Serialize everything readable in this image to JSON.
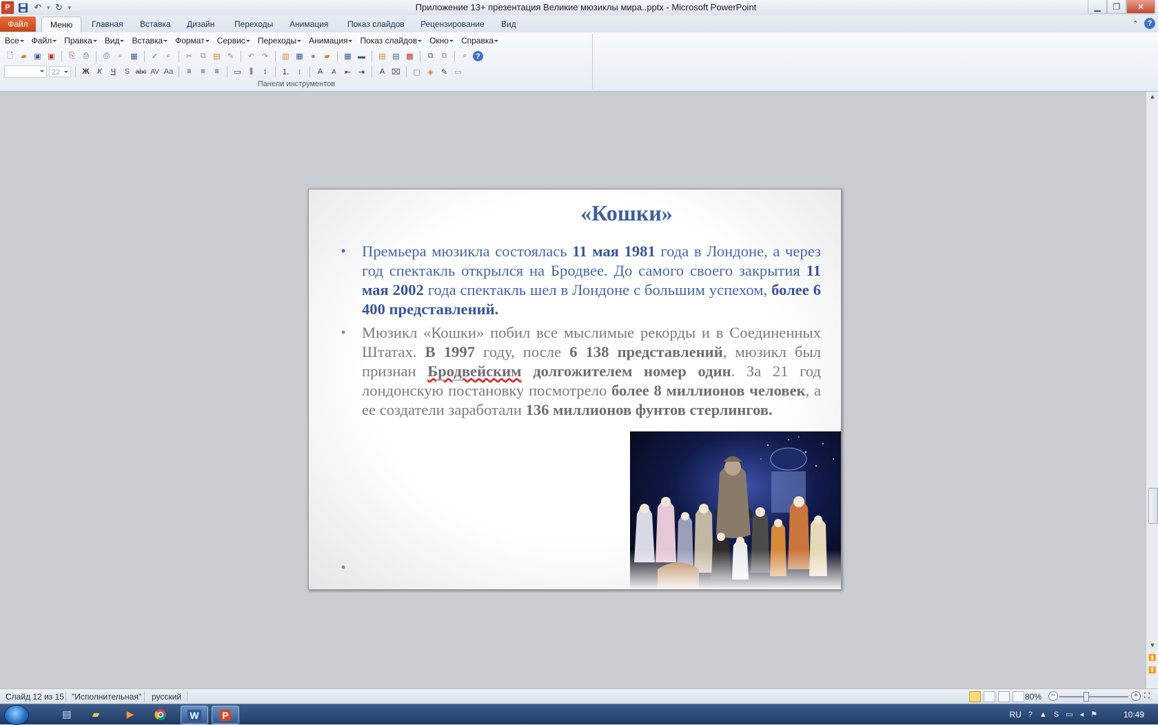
{
  "window": {
    "title": "Приложение 13+ презентация Великие мюзиклы мира..pptx - Microsoft PowerPoint",
    "controls": [
      "minimize-icon",
      "restore-icon",
      "close-icon"
    ]
  },
  "tabs": [
    "Файл",
    "Меню",
    "Главная",
    "Вставка",
    "Дизайн",
    "Переходы",
    "Анимация",
    "Показ слайдов",
    "Рецензирование",
    "Вид"
  ],
  "active_tab": "Меню",
  "menus": [
    "Все",
    "Файл",
    "Правка",
    "Вид",
    "Вставка",
    "Формат",
    "Сервис",
    "Переходы",
    "Анимация",
    "Показ слайдов",
    "Окно",
    "Справка"
  ],
  "toolbar": {
    "group_label": "Панели инструментов",
    "font_size_value": "22"
  },
  "slide": {
    "title": "«Кошки»",
    "bullet1": {
      "t1": "Премьера мюзикла состоялась ",
      "b1": "11 мая 1981",
      "t2": " года в Лондоне, а через год спектакль открылся  на Бродвее. До самого своего закрытия ",
      "b2": "11 мая 2002",
      "t3": " года  спектакль шел в Лондоне с большим успехом, ",
      "b3": "более 6 400 представлений."
    },
    "bullet2": {
      "t1": "Мюзикл «Кошки» побил все мыслимые рекорды и в Соединенных Штатах. ",
      "b1": "В 1997",
      "t2": " году,  после ",
      "b2": "6 138 представлений",
      "t3": ", мюзикл был признан ",
      "b3": "Бродвейским",
      "t4": " ",
      "b4": "долгожителем номер один",
      "t5": ". За 21 год лондонскую постановку посмотрело ",
      "b5": "более 8 миллионов человек",
      "t6": ", а ее создатели заработали ",
      "b6": "136 миллионов фунтов стерлингов."
    },
    "bullet_char": "•"
  },
  "status": {
    "slide_counter": "Слайд 12 из 15",
    "theme": "\"Исполнительная\"",
    "language": "русский",
    "zoom": "80%"
  },
  "taskbar": {
    "apps": [
      "notepad-icon",
      "explorer-icon",
      "media-player-icon",
      "chrome-icon",
      "word-icon",
      "powerpoint-icon"
    ],
    "tray_lang": "RU",
    "clock": "10:49"
  },
  "colors": {
    "slide_title": "#3e5f9e",
    "bullet1_text": "#4565a8",
    "bullet2_text": "#7a7a7a",
    "file_tab": "#d9572a"
  }
}
